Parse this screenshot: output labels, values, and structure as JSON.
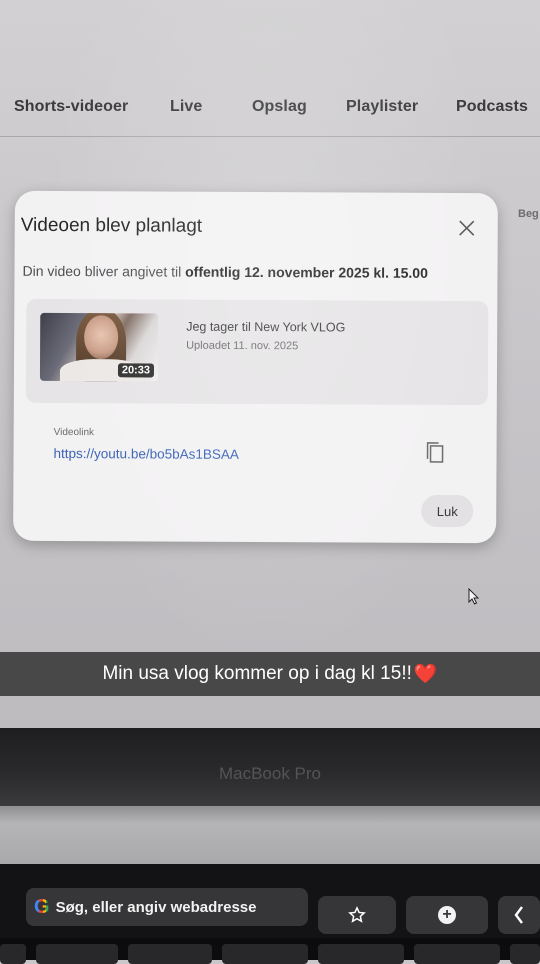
{
  "tabs": [
    "Shorts-videoer",
    "Live",
    "Opslag",
    "Playlister",
    "Podcasts"
  ],
  "side_cut_text": "Beg",
  "dialog": {
    "title": "Videoen blev planlagt",
    "subtitle_prefix": "Din video bliver angivet til ",
    "subtitle_bold": "offentlig 12. november 2025 kl. 15.00",
    "video": {
      "title": "Jeg tager til New York VLOG",
      "uploaded": "Uploadet 11. nov. 2025",
      "duration": "20:33"
    },
    "link_label": "Videolink",
    "link_value": "https://youtu.be/bo5bAs1BSAA",
    "copy_icon": "copy-icon",
    "close_icon": "close-icon",
    "close_button_label": "Luk"
  },
  "caption": {
    "text": "Min usa vlog kommer op i dag kl 15!!",
    "emoji": "❤️"
  },
  "laptop": {
    "brand": "MacBook Pro",
    "touchbar_search": "Søg, eller angiv webadresse",
    "touchbar_google_logo": "G"
  },
  "colors": {
    "link": "#3a62b7",
    "heart": "#d81e2c"
  }
}
